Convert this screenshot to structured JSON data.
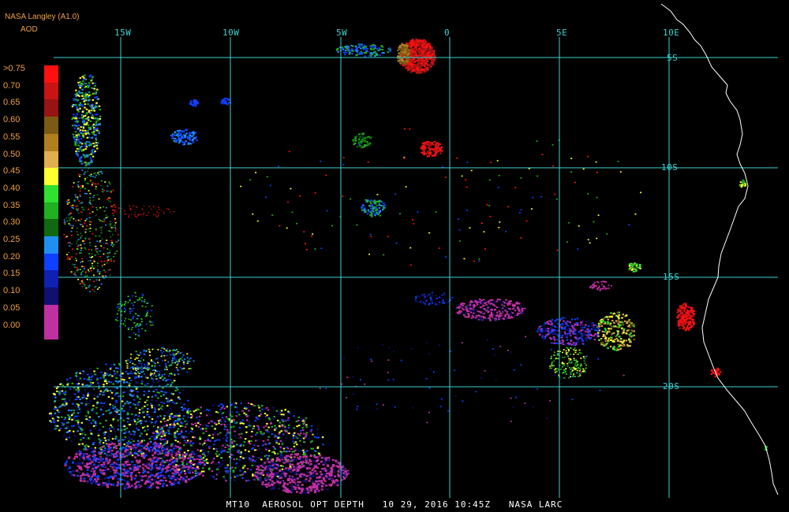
{
  "header": {
    "product": "NASA Langley (A1.0)",
    "parameter": "AOD"
  },
  "legend": {
    "labels": [
      ">0.75",
      "0.70",
      "0.65",
      "0.60",
      "0.55",
      "0.50",
      "0.45",
      "0.40",
      "0.35",
      "0.30",
      "0.25",
      "0.20",
      "0.15",
      "0.10",
      "0.05",
      "0.00"
    ],
    "colors": [
      "#ff1010",
      "#c81414",
      "#961414",
      "#7a5a14",
      "#b08020",
      "#e0b050",
      "#ffff30",
      "#30e030",
      "#20b020",
      "#106810",
      "#2090f0",
      "#1040ff",
      "#1020b0",
      "#101070",
      "#c030a0",
      "#c030a0"
    ]
  },
  "grid": {
    "longitudes": [
      "15W",
      "10W",
      "5W",
      "0",
      "5E",
      "10E"
    ],
    "latitudes": [
      "5S",
      "10S",
      "15S",
      "20S"
    ],
    "line_color": "#40d0d0"
  },
  "footer": {
    "text": "MT10  AEROSOL OPT DEPTH   10 29, 2016 10:45Z   NASA LARC"
  },
  "colors": {
    "background": "#000000",
    "coastline": "#ffffff",
    "header_text": "#f0a040",
    "grid": "#40d0d0"
  }
}
